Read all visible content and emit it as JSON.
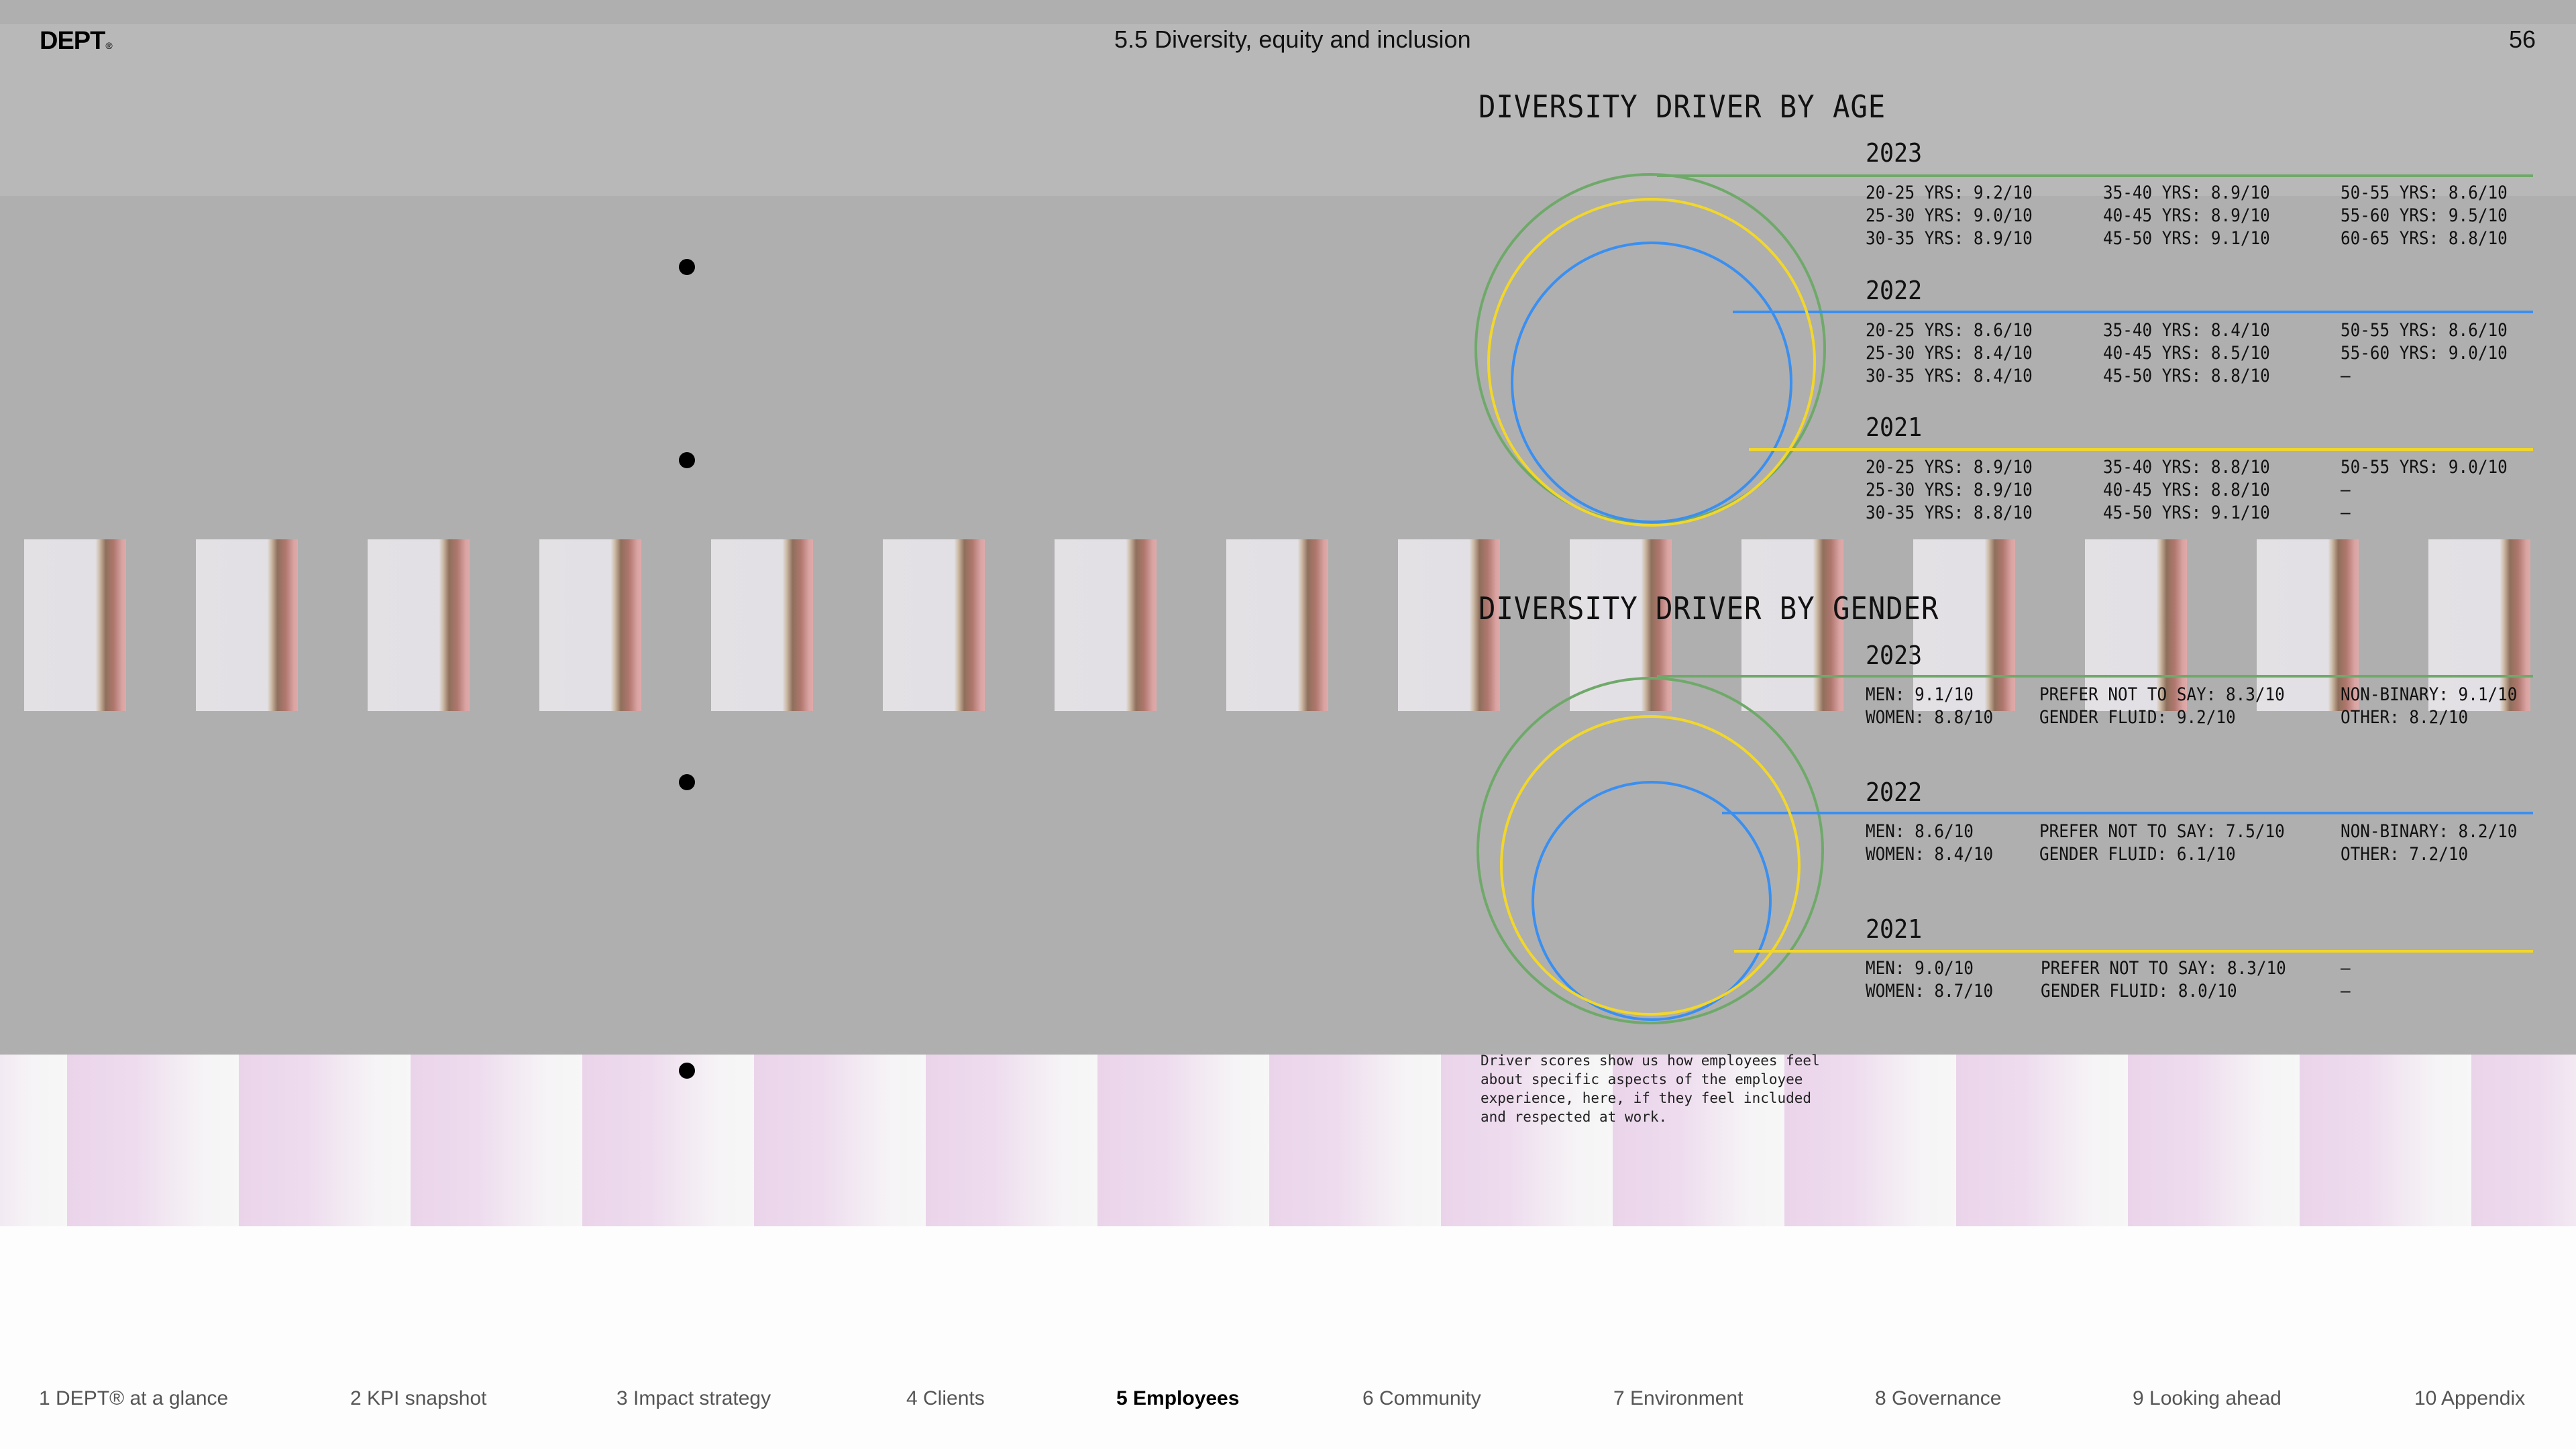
{
  "header": {
    "logo": "DEPT",
    "logo_mark": "®",
    "title": "5.5 Diversity, equity and inclusion",
    "page_number": "56"
  },
  "colors": {
    "year_2023": "#6fa96a",
    "year_2022": "#3a8ff0",
    "year_2021": "#f2d72a"
  },
  "age_section": {
    "title": "DIVERSITY DRIVER BY AGE",
    "years": [
      {
        "year": "2023",
        "color_key": "year_2023",
        "rows": [
          [
            "20-25 YRS: 9.2/10",
            "35-40 YRS: 8.9/10",
            "50-55 YRS: 8.6/10"
          ],
          [
            "25-30 YRS: 9.0/10",
            "40-45 YRS: 8.9/10",
            "55-60 YRS: 9.5/10"
          ],
          [
            "30-35 YRS: 8.9/10",
            "45-50 YRS: 9.1/10",
            "60-65 YRS: 8.8/10"
          ]
        ]
      },
      {
        "year": "2022",
        "color_key": "year_2022",
        "rows": [
          [
            "20-25 YRS: 8.6/10",
            "35-40 YRS: 8.4/10",
            "50-55 YRS: 8.6/10"
          ],
          [
            "25-30 YRS: 8.4/10",
            "40-45 YRS: 8.5/10",
            "55-60 YRS: 9.0/10"
          ],
          [
            "30-35 YRS: 8.4/10",
            "45-50 YRS: 8.8/10",
            "–"
          ]
        ]
      },
      {
        "year": "2021",
        "color_key": "year_2021",
        "rows": [
          [
            "20-25 YRS: 8.9/10",
            "35-40 YRS: 8.8/10",
            "50-55 YRS: 9.0/10"
          ],
          [
            "25-30 YRS: 8.9/10",
            "40-45 YRS: 8.8/10",
            "–"
          ],
          [
            "30-35 YRS: 8.8/10",
            "45-50 YRS: 9.1/10",
            "–"
          ]
        ]
      }
    ]
  },
  "gender_section": {
    "title": "DIVERSITY DRIVER BY GENDER",
    "years": [
      {
        "year": "2023",
        "color_key": "year_2023",
        "rows": [
          [
            "MEN: 9.1/10",
            "PREFER NOT TO SAY: 8.3/10",
            "NON-BINARY: 9.1/10"
          ],
          [
            "WOMEN: 8.8/10",
            "GENDER FLUID: 9.2/10",
            "OTHER: 8.2/10"
          ]
        ]
      },
      {
        "year": "2022",
        "color_key": "year_2022",
        "rows": [
          [
            "MEN: 8.6/10",
            "PREFER NOT TO SAY: 7.5/10",
            "NON-BINARY: 8.2/10"
          ],
          [
            "WOMEN: 8.4/10",
            "GENDER FLUID: 6.1/10",
            "OTHER: 7.2/10"
          ]
        ]
      },
      {
        "year": "2021",
        "color_key": "year_2021",
        "rows": [
          [
            "MEN: 9.0/10",
            "PREFER NOT TO SAY: 8.3/10",
            "–"
          ],
          [
            "WOMEN: 8.7/10",
            "GENDER FLUID: 8.0/10",
            "–"
          ]
        ]
      }
    ]
  },
  "footnote": "Driver scores show us how employees feel\nabout specific aspects of the employee\nexperience, here, if they feel included\nand respected at work.",
  "nav": {
    "items": [
      {
        "label": "1  DEPT® at a glance",
        "active": false
      },
      {
        "label": "2  KPI snapshot",
        "active": false
      },
      {
        "label": "3  Impact strategy",
        "active": false
      },
      {
        "label": "4  Clients",
        "active": false
      },
      {
        "label": "5  Employees",
        "active": true
      },
      {
        "label": "6  Community",
        "active": false
      },
      {
        "label": "7  Environment",
        "active": false
      },
      {
        "label": "8  Governance",
        "active": false
      },
      {
        "label": "9  Looking ahead",
        "active": false
      },
      {
        "label": "10  Appendix",
        "active": false
      }
    ]
  }
}
